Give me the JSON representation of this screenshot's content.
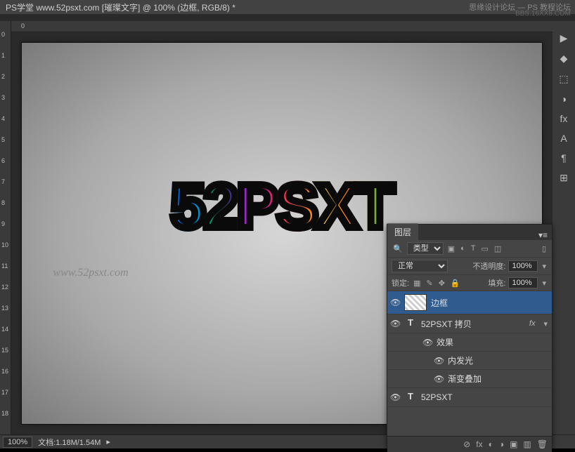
{
  "titlebar": {
    "text": "PS学堂  www.52psxt.com [璀璨文字] @ 100% (边框, RGB/8) *"
  },
  "watermark": {
    "top1": "思缘设计论坛 — PS 教程论坛",
    "top2": "BBS.16XX8.COM",
    "canvas": "www.52psxt.com"
  },
  "artwork": {
    "ch1": "5",
    "ch2": "2",
    "ch3": "P",
    "ch4": "S",
    "ch5": "X",
    "ch6": "T"
  },
  "ruler_top": {
    "t0": "0"
  },
  "ruler_left": {
    "t0": "0",
    "t1": "1",
    "t2": "2",
    "t3": "3",
    "t4": "4",
    "t5": "5",
    "t6": "6",
    "t7": "7",
    "t8": "8",
    "t9": "9",
    "t10": "10",
    "t11": "11",
    "t12": "12",
    "t13": "13",
    "t14": "14",
    "t15": "15",
    "t16": "16",
    "t17": "17",
    "t18": "18"
  },
  "status": {
    "zoom": "100%",
    "doc": "文档:1.18M/1.54M"
  },
  "right_tools": {
    "play": "▶",
    "color": "◆",
    "shapes": "⬚",
    "eye": "◑",
    "fx": "fx",
    "alpha": "A",
    "para": "¶",
    "libs": "⊞"
  },
  "layers": {
    "tab": "图层",
    "type_label": "类型",
    "filter_icons": {
      "img": "▣",
      "adj": "◐",
      "type": "T",
      "shape": "▭",
      "smart": "◫"
    },
    "blend": "正常",
    "opacity_label": "不透明度:",
    "opacity_val": "100%",
    "lock_label": "锁定:",
    "lock_icons": {
      "grid": "▦",
      "brush": "✎",
      "move": "✥",
      "all": "🔒"
    },
    "fill_label": "填充:",
    "fill_val": "100%",
    "items": [
      {
        "name": "边框",
        "type": "smart"
      },
      {
        "name": "52PSXT 拷贝",
        "type": "text",
        "fx": "fx"
      },
      {
        "sub": true,
        "name": "效果"
      },
      {
        "sub2": true,
        "name": "内发光"
      },
      {
        "sub2": true,
        "name": "渐变叠加"
      },
      {
        "name": "52PSXT",
        "type": "text"
      }
    ],
    "footer": {
      "link": "⊘",
      "fx": "fx",
      "mask": "◐",
      "folder": "▣",
      "adj": "◑",
      "new": "▥",
      "trash": "🗑"
    }
  }
}
